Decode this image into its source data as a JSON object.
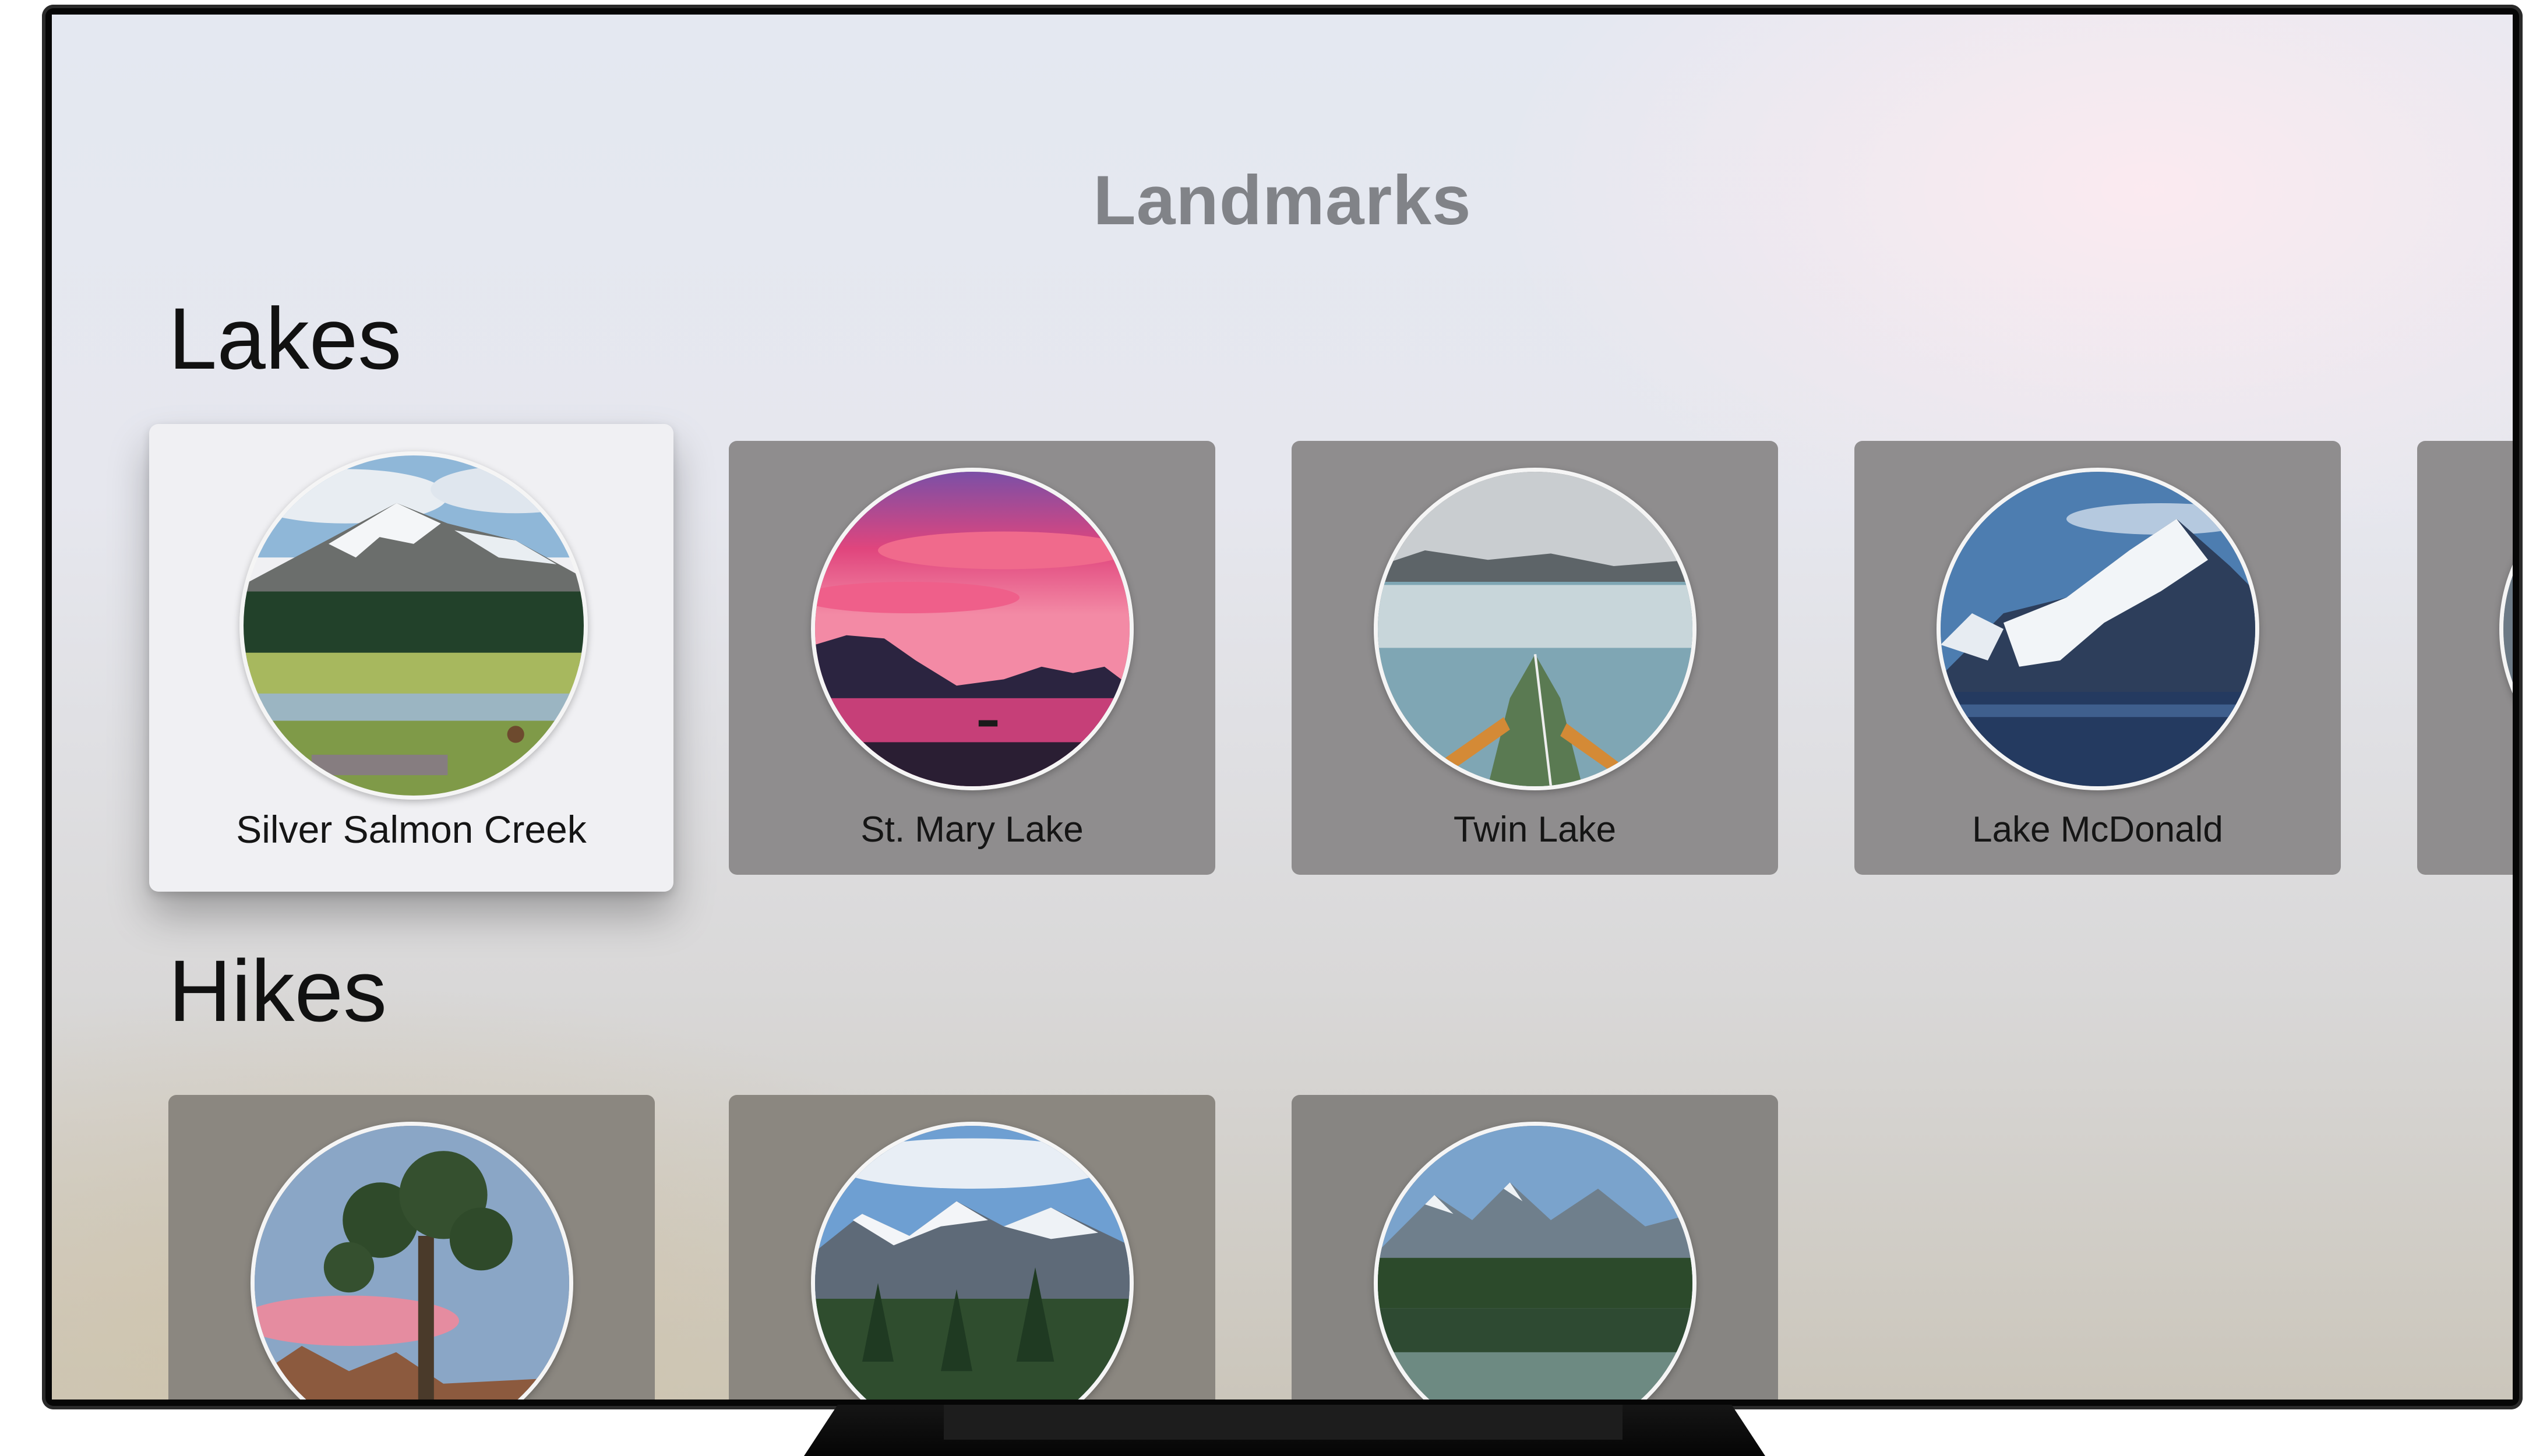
{
  "app": {
    "title": "Landmarks"
  },
  "sections": {
    "lakes": {
      "title": "Lakes",
      "items": [
        {
          "label": "Silver Salmon Creek",
          "image": "mountain-meadow-photo",
          "focused": true
        },
        {
          "label": "St. Mary Lake",
          "image": "pink-sunset-lake-photo"
        },
        {
          "label": "Twin Lake",
          "image": "kayak-lake-photo"
        },
        {
          "label": "Lake McDonald",
          "image": "snowy-peak-lake-photo"
        },
        {
          "label": "",
          "image": "partially-visible-card"
        }
      ]
    },
    "hikes": {
      "title": "Hikes",
      "items": [
        {
          "label": "",
          "image": "joshua-tree-photo"
        },
        {
          "label": "",
          "image": "alpine-forest-photo"
        },
        {
          "label": "",
          "image": "mountain-lake-reflection-photo"
        }
      ]
    }
  },
  "colors": {
    "title_text": "#818388",
    "card_background": "#8f8d8e",
    "focused_card_background": "#f0f0f3"
  }
}
